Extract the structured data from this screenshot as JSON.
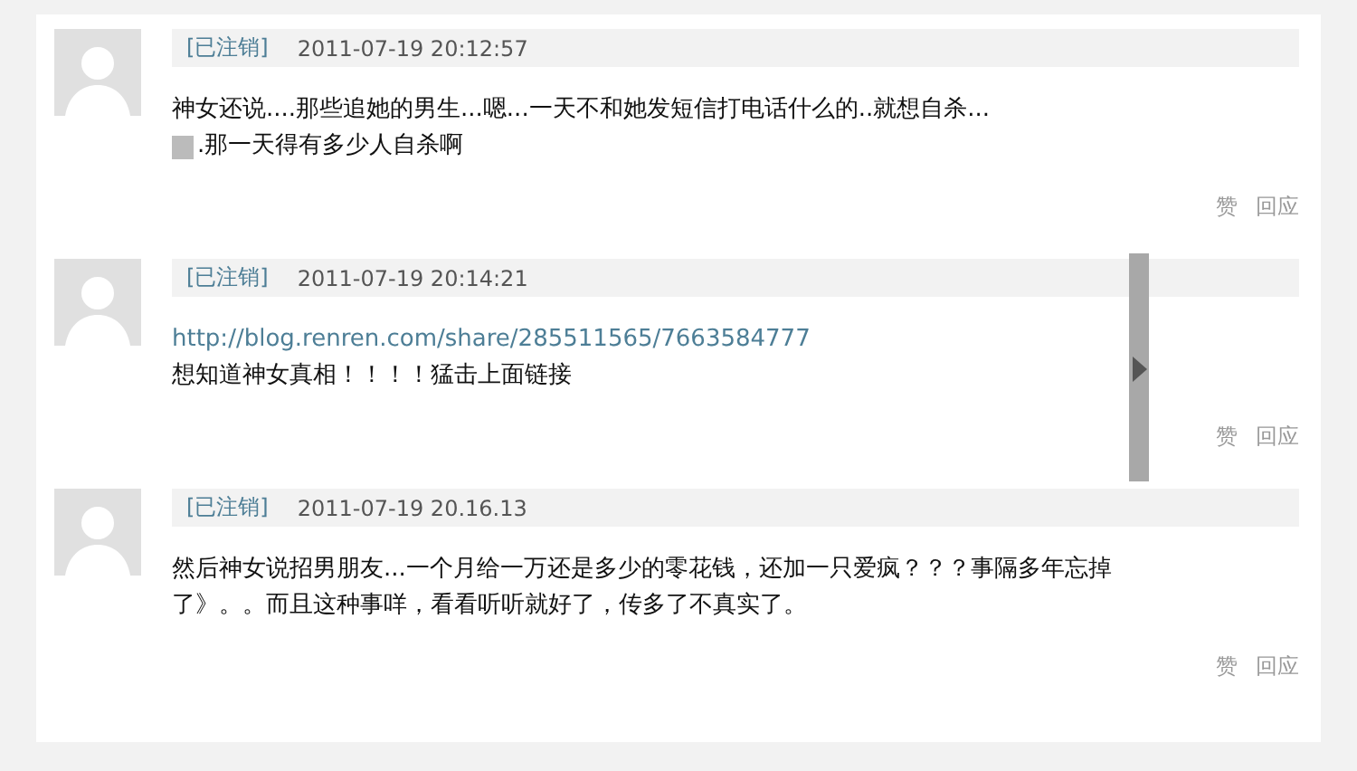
{
  "comments": [
    {
      "user": "[已注销]",
      "time": "2011-07-19 20:12:57",
      "lines": [
        [
          {
            "kind": "text",
            "text": "神女还说....那些追她的男生...嗯...一天不和她发短信打电话什么的..就想自杀..."
          }
        ],
        [
          {
            "kind": "emoticon"
          },
          {
            "kind": "text",
            "text": ".那一天得有多少人自杀啊"
          }
        ]
      ],
      "actions": [
        "赞",
        "回应"
      ]
    },
    {
      "user": "[已注销]",
      "time": "2011-07-19 20:14:21",
      "lines": [
        [
          {
            "kind": "link",
            "text": "http://blog.renren.com/share/285511565/7663584777"
          }
        ],
        [
          {
            "kind": "text",
            "text": "想知道神女真相！！！！猛击上面链接"
          }
        ]
      ],
      "actions": [
        "赞",
        "回应"
      ]
    },
    {
      "user": "[已注销]",
      "time": "2011-07-19 20.16.13",
      "lines": [
        [
          {
            "kind": "text",
            "text": "然后神女说招男朋友...一个月给一万还是多少的零花钱，还加一只爱疯？？？事隔多年忘掉了》。。而且这种事咩，看看听听就好了，传多了不真实了。"
          }
        ]
      ],
      "actions": [
        "赞",
        "回应"
      ]
    }
  ]
}
